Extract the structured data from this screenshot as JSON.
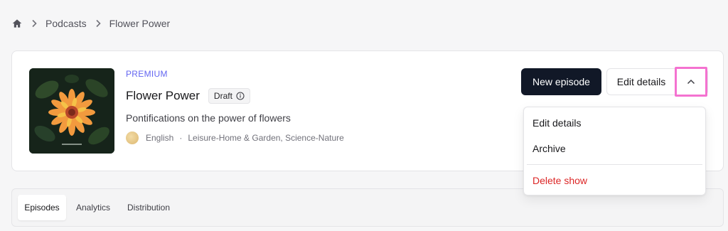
{
  "breadcrumb": {
    "home_icon": "home-icon",
    "items": [
      "Podcasts",
      "Flower Power"
    ]
  },
  "show": {
    "tier": "PREMIUM",
    "title": "Flower Power",
    "status_badge": "Draft",
    "description": "Pontifications on the power of flowers",
    "language": "English",
    "separator": "·",
    "categories": "Leisure-Home & Garden, Science-Nature"
  },
  "actions": {
    "new_episode": "New episode",
    "edit_details": "Edit details",
    "toggle_icon": "chevron-up-icon"
  },
  "dropdown": {
    "items": [
      "Edit details",
      "Archive"
    ],
    "danger_item": "Delete show"
  },
  "tabs": [
    "Episodes",
    "Analytics",
    "Distribution"
  ],
  "colors": {
    "accent": "#6366f1",
    "primary_button": "#111827",
    "danger": "#dc2626",
    "focus_outline": "#f472d0"
  }
}
